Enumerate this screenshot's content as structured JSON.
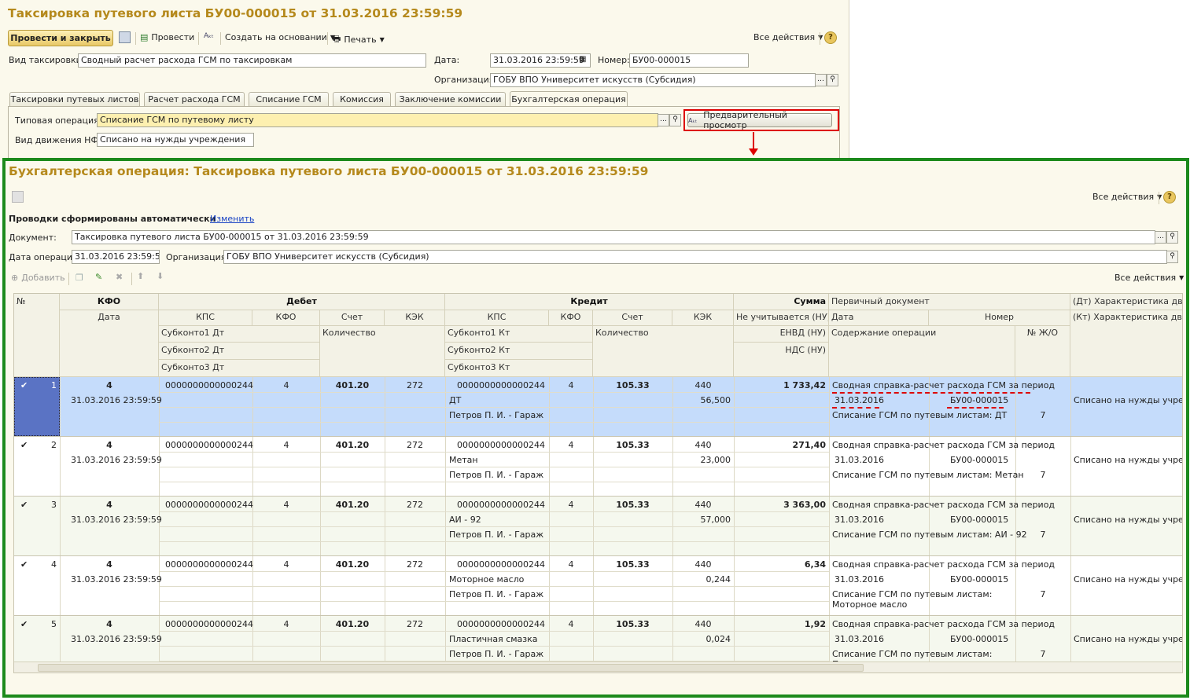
{
  "back": {
    "title": "Таксировка путевого листа БУ00-000015 от 31.03.2016 23:59:59",
    "toolbar": {
      "post_close": "Провести и закрыть",
      "post": "Провести",
      "create_basis": "Создать на основании",
      "print": "Печать",
      "all_actions": "Все действия"
    },
    "fields": {
      "vid_label": "Вид таксировки:",
      "vid_value": "Сводный расчет расхода ГСМ по таксировкам",
      "date_label": "Дата:",
      "date_value": "31.03.2016 23:59:59",
      "number_label": "Номер:",
      "number_value": "БУ00-000015",
      "org_label": "Организация:",
      "org_value": "ГОБУ ВПО Университет искусств (Субсидия)"
    },
    "tabs": [
      "Таксировки путевых листов",
      "Расчет расхода ГСМ",
      "Списание ГСМ",
      "Комиссия",
      "Заключение комиссии",
      "Бухгалтерская операция"
    ],
    "typ_label": "Типовая операция:",
    "typ_value": "Списание ГСМ по путевому листу",
    "preview": "Предварительный просмотр",
    "nfa_label": "Вид движения НФА:",
    "nfa_value": "Списано на нужды учреждения"
  },
  "front": {
    "title": "Бухгалтерская операция: Таксировка путевого листа БУ00-000015 от 31.03.2016 23:59:59",
    "all_actions": "Все действия",
    "auto_label": "Проводки сформированы автоматически",
    "change_link": "Изменить",
    "doc_label": "Документ:",
    "doc_value": "Таксировка путевого листа БУ00-000015 от 31.03.2016 23:59:59",
    "opdate_label": "Дата операции:",
    "opdate_value": "31.03.2016 23:59:59",
    "org_label": "Организация:",
    "org_value": "ГОБУ ВПО Университет искусств (Субсидия)",
    "add": "Добавить",
    "all_actions2": "Все действия"
  },
  "table": {
    "h": {
      "num": "№",
      "kfo": "КФО",
      "debet": "Дебет",
      "kredit": "Кредит",
      "summa": "Сумма",
      "perv": "Первичный документ",
      "dtchar": "(Дт) Характеристика движе",
      "date": "Дата",
      "kps": "КПС",
      "kfo2": "КФО",
      "schet": "Счет",
      "kek": "КЭК",
      "ne_uch": "Не учитывается (НУ)",
      "pdate": "Дата",
      "pnum": "Номер",
      "ktchar": "(Кт) Характеристика движе",
      "sub1dt": "Субконто1 Дт",
      "sub2dt": "Субконто2 Дт",
      "sub3dt": "Субконто3 Дт",
      "kol": "Количество",
      "sub1kt": "Субконто1 Кт",
      "sub2kt": "Субконто2 Кт",
      "sub3kt": "Субконто3 Кт",
      "envd": "ЕНВД (НУ)",
      "nds": "НДС (НУ)",
      "content": "Содержание операции",
      "jo": "№ Ж/О"
    },
    "rows": [
      {
        "n": "1",
        "kfo": "4",
        "date": "31.03.2016 23:59:59",
        "dkps": "0000000000000244",
        "dkfo": "4",
        "dschet": "401.20",
        "dkek": "272",
        "kkps": "0000000000000244",
        "kkfo": "4",
        "kschet": "105.33",
        "kkek": "440",
        "sub1": "ДТ",
        "sub2": "Петров П. И. - Гараж",
        "qty": "56,500",
        "sum": "1 733,42",
        "pd1": "Сводная справка-расчет расхода ГСМ за период",
        "pdate": "31.03.2016",
        "pnum": "БУ00-000015",
        "pc1": "Списание ГСМ по путевым листам: ДТ",
        "pc2": "",
        "jo": "7",
        "dt": "Списано на нужды учрежде"
      },
      {
        "n": "2",
        "kfo": "4",
        "date": "31.03.2016 23:59:59",
        "dkps": "0000000000000244",
        "dkfo": "4",
        "dschet": "401.20",
        "dkek": "272",
        "kkps": "0000000000000244",
        "kkfo": "4",
        "kschet": "105.33",
        "kkek": "440",
        "sub1": "Метан",
        "sub2": "Петров П. И. - Гараж",
        "qty": "23,000",
        "sum": "271,40",
        "pd1": "Сводная справка-расчет расхода ГСМ за период",
        "pdate": "31.03.2016",
        "pnum": "БУ00-000015",
        "pc1": "Списание ГСМ по путевым листам: Метан",
        "pc2": "",
        "jo": "7",
        "dt": "Списано на нужды учрежде"
      },
      {
        "n": "3",
        "kfo": "4",
        "date": "31.03.2016 23:59:59",
        "dkps": "0000000000000244",
        "dkfo": "4",
        "dschet": "401.20",
        "dkek": "272",
        "kkps": "0000000000000244",
        "kkfo": "4",
        "kschet": "105.33",
        "kkek": "440",
        "sub1": "АИ - 92",
        "sub2": "Петров П. И. - Гараж",
        "qty": "57,000",
        "sum": "3 363,00",
        "pd1": "Сводная справка-расчет расхода ГСМ за период",
        "pdate": "31.03.2016",
        "pnum": "БУ00-000015",
        "pc1": "Списание ГСМ по путевым листам: АИ - 92",
        "pc2": "",
        "jo": "7",
        "dt": "Списано на нужды учрежде"
      },
      {
        "n": "4",
        "kfo": "4",
        "date": "31.03.2016 23:59:59",
        "dkps": "0000000000000244",
        "dkfo": "4",
        "dschet": "401.20",
        "dkek": "272",
        "kkps": "0000000000000244",
        "kkfo": "4",
        "kschet": "105.33",
        "kkek": "440",
        "sub1": "Моторное масло",
        "sub2": "Петров П. И. - Гараж",
        "qty": "0,244",
        "sum": "6,34",
        "pd1": "Сводная справка-расчет расхода ГСМ за период",
        "pdate": "31.03.2016",
        "pnum": "БУ00-000015",
        "pc1": "Списание ГСМ по путевым листам:",
        "pc2": "Моторное масло",
        "jo": "7",
        "dt": "Списано на нужды учрежде"
      },
      {
        "n": "5",
        "kfo": "4",
        "date": "31.03.2016 23:59:59",
        "dkps": "0000000000000244",
        "dkfo": "4",
        "dschet": "401.20",
        "dkek": "272",
        "kkps": "0000000000000244",
        "kkfo": "4",
        "kschet": "105.33",
        "kkek": "440",
        "sub1": "Пластичная смазка",
        "sub2": "Петров П. И. - Гараж",
        "qty": "0,024",
        "sum": "1,92",
        "pd1": "Сводная справка-расчет расхода ГСМ за период",
        "pdate": "31.03.2016",
        "pnum": "БУ00-000015",
        "pc1": "Списание ГСМ по путевым листам:",
        "pc2": "Пластичная смазка",
        "jo": "7",
        "dt": "Списано на нужды учрежде"
      }
    ]
  },
  "colors": {
    "title": "#b5891c",
    "frame": "#1c8a1c",
    "highlight": "#d00000",
    "selected": "#c5dcfb"
  }
}
